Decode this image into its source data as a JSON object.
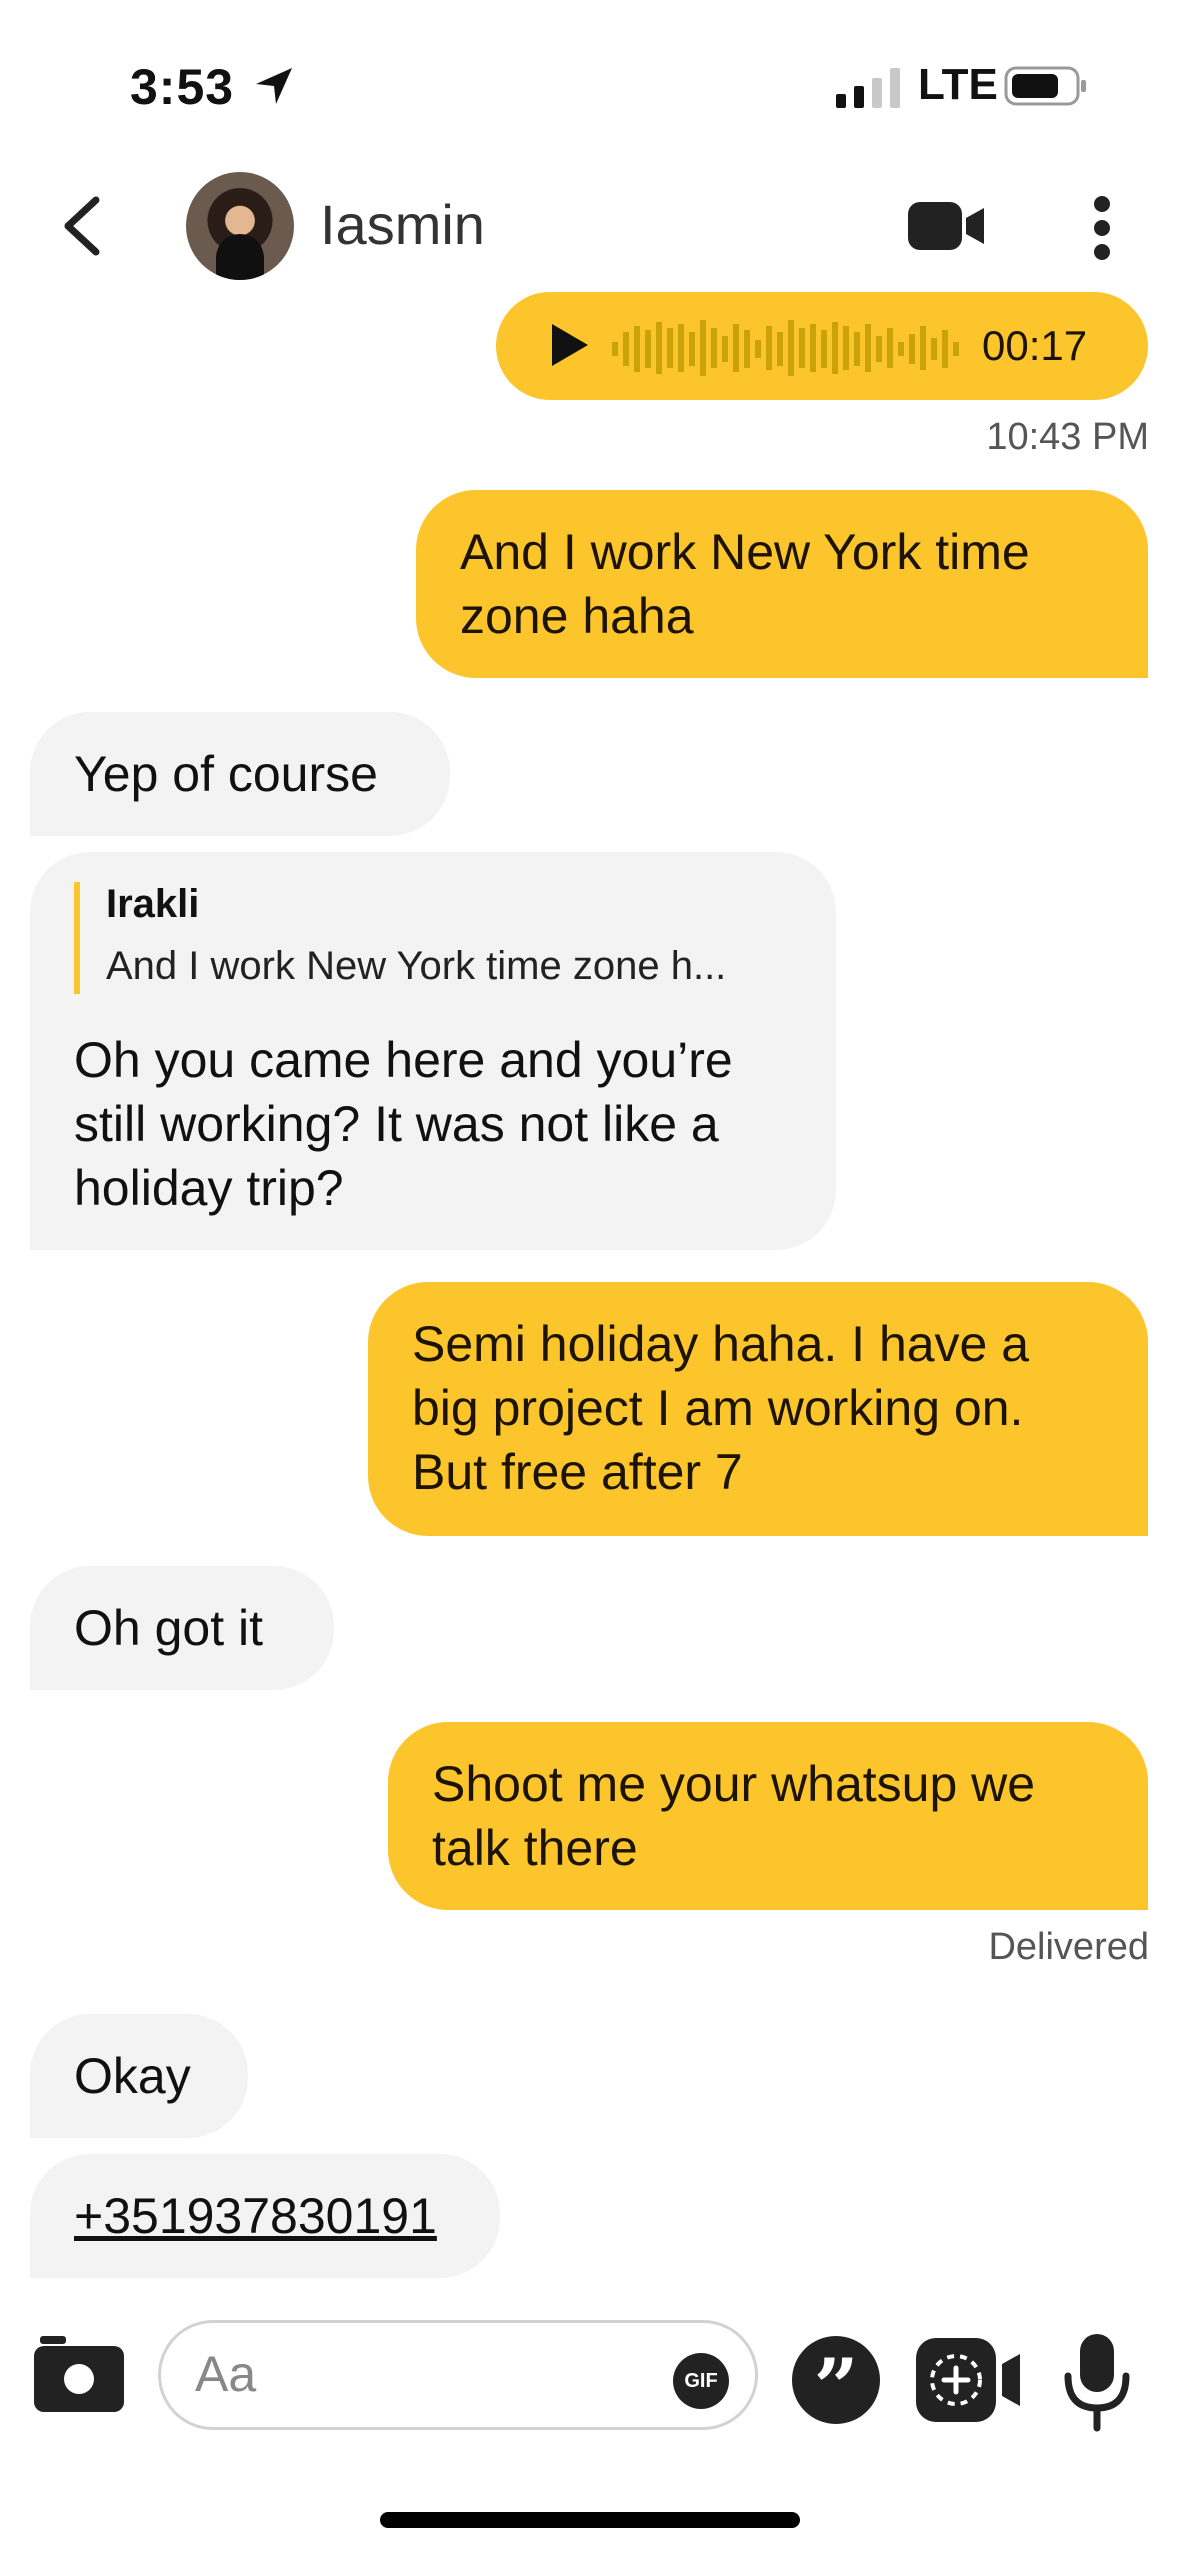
{
  "status_bar": {
    "time": "3:53",
    "network": "LTE"
  },
  "header": {
    "contact_name": "Iasmin"
  },
  "messages": {
    "voice": {
      "duration": "00:17"
    },
    "timestamp_1": "10:43 PM",
    "m1": "And I work New York time zone haha",
    "m2": "Yep of course",
    "m3": {
      "quote_author": "Irakli",
      "quote_text": "And I work New York time zone h...",
      "body": "Oh you came here and you’re still working? It was not like a holiday trip?"
    },
    "m4": "Semi holiday haha. I have a big project I am working on. But free after 7",
    "m5": "Oh got it",
    "m6": "Shoot me your whatsup we talk there",
    "status_delivered": "Delivered",
    "m7": "Okay",
    "m8": "+351937830191"
  },
  "composer": {
    "placeholder": "Aa",
    "gif_label": "GIF"
  },
  "colors": {
    "outgoing": "#fcc52b",
    "incoming": "#f3f3f3"
  }
}
